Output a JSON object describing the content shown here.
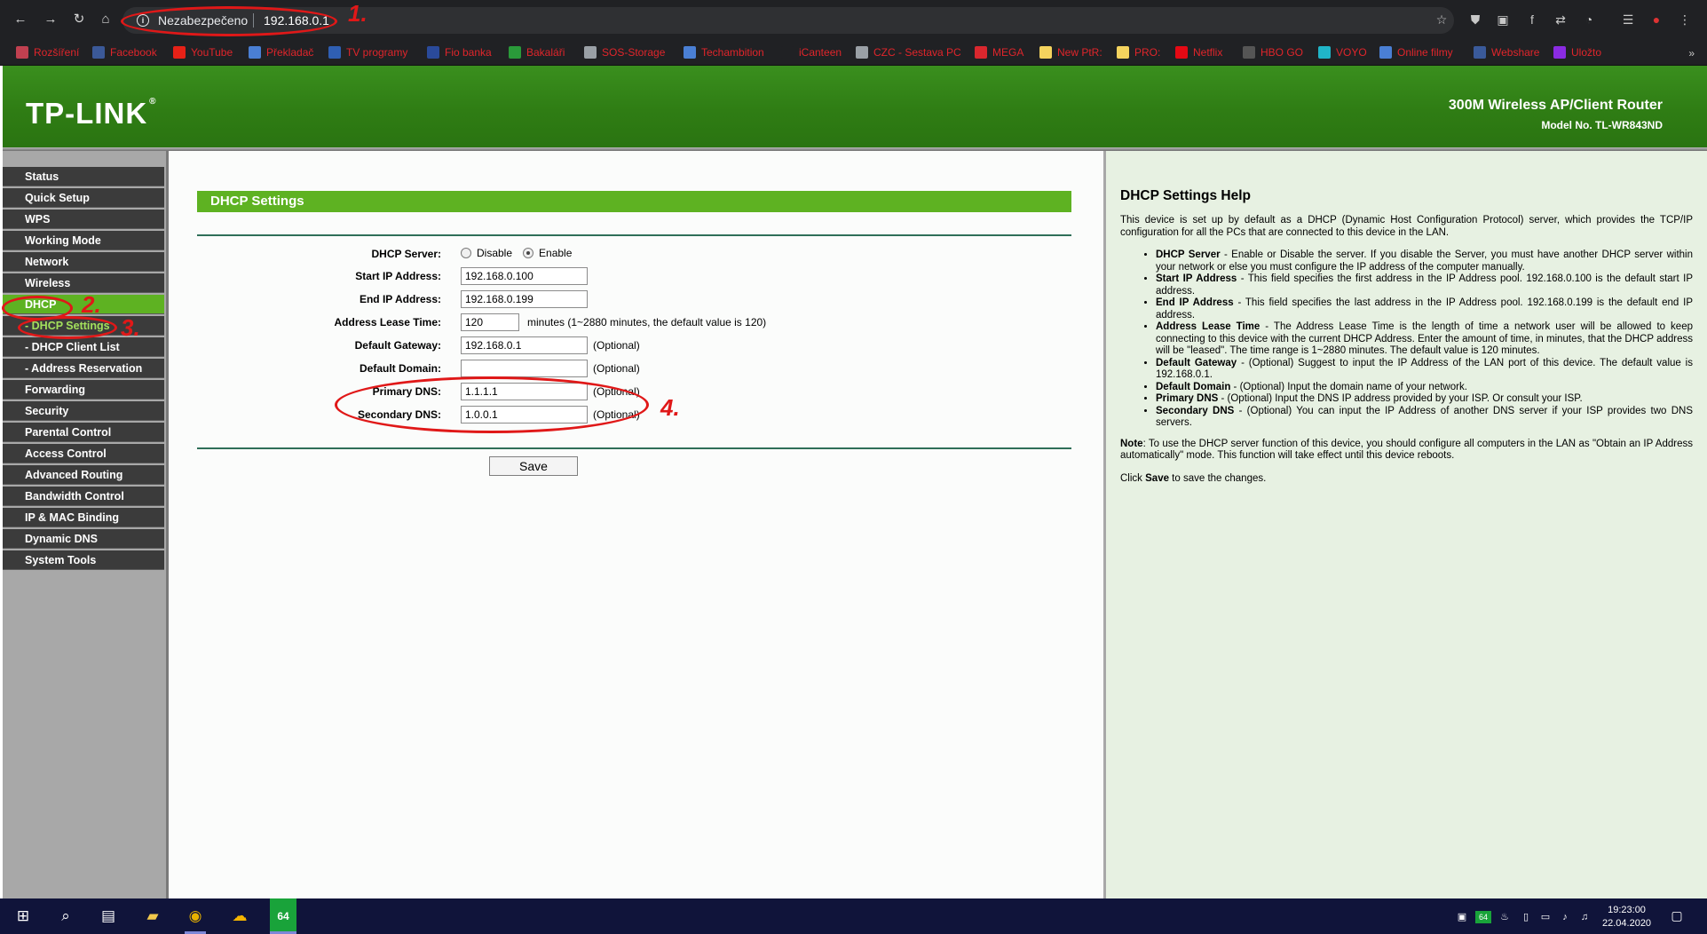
{
  "browser": {
    "security_label": "Nezabezpečeno",
    "url": "192.168.0.1",
    "bookmarks": [
      {
        "label": "Rozšíření",
        "icon": "puzzle-icon",
        "color": "#c04050"
      },
      {
        "label": "Facebook",
        "icon": "f",
        "color": "#3b5998"
      },
      {
        "label": "YouTube",
        "icon": "▶",
        "color": "#e62117"
      },
      {
        "label": "Překladač",
        "icon": "G",
        "color": "#4a7fd4"
      },
      {
        "label": "TV programy",
        "icon": "tv",
        "color": "#2f5fb3"
      },
      {
        "label": "Fio banka",
        "icon": "F",
        "color": "#2a4a9a"
      },
      {
        "label": "Bakaláři",
        "icon": "B",
        "color": "#2a9a3a"
      },
      {
        "label": "SOS-Storage",
        "icon": "☁",
        "color": "#9aa0a6"
      },
      {
        "label": "Techambition",
        "icon": "T",
        "color": "#4a7fd4"
      },
      {
        "label": "iCanteen",
        "icon": "i",
        "color": "#202124"
      },
      {
        "label": "CZC - Sestava PC",
        "icon": "CZC",
        "color": "#9aa0a6"
      },
      {
        "label": "MEGA",
        "icon": "M",
        "color": "#d9272e"
      },
      {
        "label": "New PtR:",
        "icon": "note",
        "color": "#f4d35e"
      },
      {
        "label": "PRO:",
        "icon": "note",
        "color": "#f4d35e"
      },
      {
        "label": "Netflix",
        "icon": "N",
        "color": "#e50914"
      },
      {
        "label": "HBO GO",
        "icon": "H",
        "color": "#555"
      },
      {
        "label": "VOYO",
        "icon": "V",
        "color": "#20b5c8"
      },
      {
        "label": "Online filmy",
        "icon": "film",
        "color": "#4a7fd4"
      },
      {
        "label": "Webshare",
        "icon": "W",
        "color": "#3a5a9a"
      },
      {
        "label": "Uložto",
        "icon": "U",
        "color": "#8a2be2"
      }
    ]
  },
  "router": {
    "logo": "TP-LINK",
    "product": "300M Wireless AP/Client Router",
    "model": "Model No. TL-WR843ND"
  },
  "sidebar": {
    "items": [
      {
        "label": "Status"
      },
      {
        "label": "Quick Setup"
      },
      {
        "label": "WPS"
      },
      {
        "label": "Working Mode"
      },
      {
        "label": "Network"
      },
      {
        "label": "Wireless"
      },
      {
        "label": "DHCP"
      },
      {
        "label": "- DHCP Settings"
      },
      {
        "label": "- DHCP Client List"
      },
      {
        "label": "- Address Reservation"
      },
      {
        "label": "Forwarding"
      },
      {
        "label": "Security"
      },
      {
        "label": "Parental Control"
      },
      {
        "label": "Access Control"
      },
      {
        "label": "Advanced Routing"
      },
      {
        "label": "Bandwidth Control"
      },
      {
        "label": "IP & MAC Binding"
      },
      {
        "label": "Dynamic DNS"
      },
      {
        "label": "System Tools"
      }
    ]
  },
  "form": {
    "title": "DHCP Settings",
    "dhcp_server_label": "DHCP Server:",
    "disable_label": "Disable",
    "enable_label": "Enable",
    "dhcp_server_value": "Enable",
    "start_ip_label": "Start IP Address:",
    "start_ip": "192.168.0.100",
    "end_ip_label": "End IP Address:",
    "end_ip": "192.168.0.199",
    "lease_label": "Address Lease Time:",
    "lease": "120",
    "lease_note": "minutes (1~2880 minutes, the default value is 120)",
    "gateway_label": "Default Gateway:",
    "gateway": "192.168.0.1",
    "domain_label": "Default Domain:",
    "domain": "",
    "primary_dns_label": "Primary DNS:",
    "primary_dns": "1.1.1.1",
    "secondary_dns_label": "Secondary DNS:",
    "secondary_dns": "1.0.0.1",
    "optional": "(Optional)",
    "save_label": "Save"
  },
  "help": {
    "title": "DHCP Settings Help",
    "intro": "This device is set up by default as a DHCP (Dynamic Host Configuration Protocol) server, which provides the TCP/IP configuration for all the PCs that are connected to this device in the LAN.",
    "items": [
      {
        "term": "DHCP Server",
        "text": " - Enable or Disable the server. If you disable the Server, you must have another DHCP server within your network or else you must configure the IP address of the computer manually."
      },
      {
        "term": "Start IP Address",
        "text": " - This field specifies the first address in the IP Address pool. 192.168.0.100 is the default start IP address."
      },
      {
        "term": "End IP Address",
        "text": " - This field specifies the last address in the IP Address pool. 192.168.0.199 is the default end IP address."
      },
      {
        "term": "Address Lease Time",
        "text": " - The Address Lease Time is the length of time a network user will be allowed to keep connecting to this device with the current DHCP Address. Enter the amount of time, in minutes, that the DHCP address will be \"leased\". The time range is 1~2880 minutes. The default value is 120 minutes."
      },
      {
        "term": "Default Gateway",
        "text": " - (Optional) Suggest to input the IP Address of the LAN port of this device. The default value is 192.168.0.1."
      },
      {
        "term": "Default Domain",
        "text": " - (Optional) Input the domain name of your network."
      },
      {
        "term": "Primary DNS",
        "text": " - (Optional) Input the DNS IP address provided by your ISP. Or consult your ISP."
      },
      {
        "term": "Secondary DNS",
        "text": " - (Optional) You can input the IP Address of another DNS server if your ISP provides two DNS servers."
      }
    ],
    "note_term": "Note",
    "note_text": ": To use the DHCP server function of this device, you should configure all computers in the LAN as \"Obtain an IP Address automatically\" mode. This function will take effect until this device reboots.",
    "click_prefix": "Click ",
    "click_term": "Save",
    "click_suffix": " to save the changes."
  },
  "annotations": {
    "n1": "1.",
    "n2": "2.",
    "n3": "3.",
    "n4": "4."
  },
  "taskbar": {
    "time": "19:23:00",
    "date": "22.04.2020",
    "badge": "64"
  }
}
